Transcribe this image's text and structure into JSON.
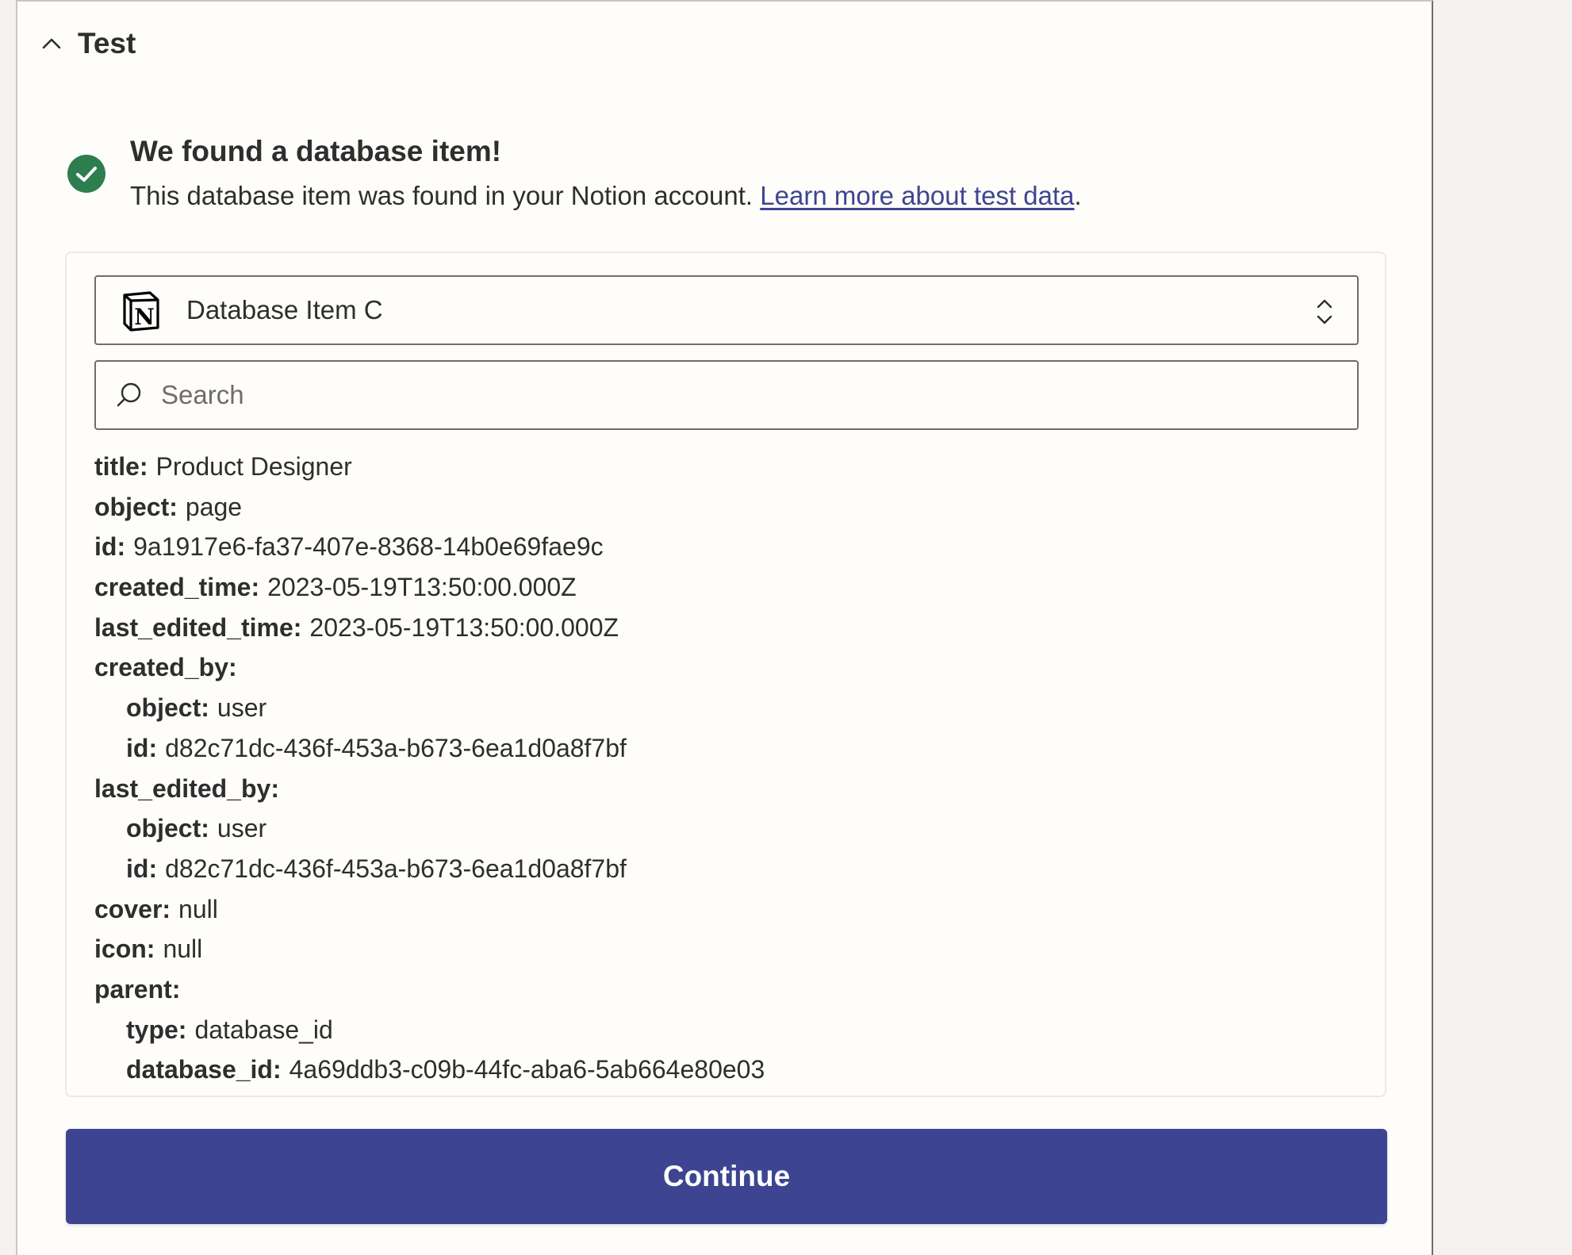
{
  "section": {
    "title": "Test"
  },
  "result": {
    "title": "We found a database item!",
    "description": "This database item was found in your Notion account. ",
    "link_text": "Learn more about test data",
    "description_end": "."
  },
  "selector": {
    "value": "Database Item C"
  },
  "search": {
    "placeholder": "Search"
  },
  "fields": [
    {
      "key": "title:",
      "value": "Product Designer"
    },
    {
      "key": "object:",
      "value": "page"
    },
    {
      "key": "id:",
      "value": "9a1917e6-fa37-407e-8368-14b0e69fae9c"
    },
    {
      "key": "created_time:",
      "value": "2023-05-19T13:50:00.000Z"
    },
    {
      "key": "last_edited_time:",
      "value": "2023-05-19T13:50:00.000Z"
    },
    {
      "key": "created_by:",
      "value": ""
    },
    {
      "key": "object:",
      "value": "user",
      "indent": true
    },
    {
      "key": "id:",
      "value": "d82c71dc-436f-453a-b673-6ea1d0a8f7bf",
      "indent": true
    },
    {
      "key": "last_edited_by:",
      "value": ""
    },
    {
      "key": "object:",
      "value": "user",
      "indent": true
    },
    {
      "key": "id:",
      "value": "d82c71dc-436f-453a-b673-6ea1d0a8f7bf",
      "indent": true
    },
    {
      "key": "cover:",
      "value": "null"
    },
    {
      "key": "icon:",
      "value": "null"
    },
    {
      "key": "parent:",
      "value": ""
    },
    {
      "key": "type:",
      "value": "database_id",
      "indent": true
    },
    {
      "key": "database_id:",
      "value": "4a69ddb3-c09b-44fc-aba6-5ab664e80e03",
      "indent": true
    }
  ],
  "continue_button": {
    "label": "Continue"
  },
  "colors": {
    "primary": "#3d4592",
    "success": "#2e7d4f",
    "text": "#2d2e2e",
    "panel_bg": "#fffdf9"
  },
  "icons": {
    "header": "chevron-up-icon",
    "status": "check-circle-icon",
    "app": "notion-logo",
    "selector": "chevron-up-down-icon",
    "search": "search-icon"
  }
}
